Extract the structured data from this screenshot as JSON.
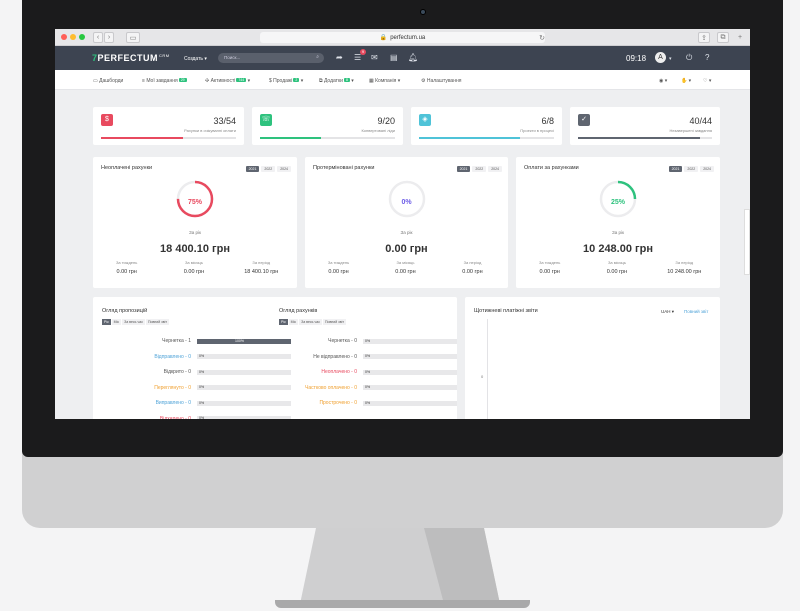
{
  "browser": {
    "url": "perfectum.ua"
  },
  "topbar": {
    "logo_mark": "7",
    "logo_text": "PERFECTUM",
    "logo_sup": "CRM",
    "create_label": "Создать",
    "search_placeholder": "Поиск...",
    "notif_count": "9",
    "time": "09:18",
    "avatar_letter": "A"
  },
  "menu": [
    {
      "label": "Дашборди"
    },
    {
      "label": "Мої завдання",
      "badge": "29"
    },
    {
      "label": "Активності",
      "badge": "744"
    },
    {
      "label": "Продажі",
      "badge": "2"
    },
    {
      "label": "Додатки",
      "badge": "8"
    },
    {
      "label": "Компанія"
    },
    {
      "label": "Налаштування"
    }
  ],
  "stats": [
    {
      "value": "33/54",
      "label": "Рахунки в очікуванні оплати",
      "color": "#e84a5f",
      "progress": 0.61
    },
    {
      "value": "9/20",
      "label": "Конвертовані ліди",
      "color": "#2ec27e",
      "progress": 0.45
    },
    {
      "value": "6/8",
      "label": "Проекти в процесі",
      "color": "#4fc3d8",
      "progress": 0.75
    },
    {
      "value": "40/44",
      "label": "Незавершені завдання",
      "color": "#5f6570",
      "progress": 0.91
    }
  ],
  "panels": [
    {
      "title": "Неоплачені рахунки",
      "years": [
        "2021",
        "2022",
        "2024"
      ],
      "percent": "75%",
      "ring_color": "#e84a5f",
      "ring_fraction": 0.75,
      "period": "За рік",
      "total": "18 400.10 грн",
      "subs": [
        {
          "label": "За тиждень",
          "value": "0.00 грн"
        },
        {
          "label": "За місяць",
          "value": "0.00 грн"
        },
        {
          "label": "За період",
          "value": "18 400.10 грн"
        }
      ]
    },
    {
      "title": "Протерміновані рахунки",
      "years": [
        "2021",
        "2022",
        "2024"
      ],
      "percent": "0%",
      "ring_color": "#6c5ce7",
      "ring_fraction": 0,
      "period": "За рік",
      "total": "0.00 грн",
      "subs": [
        {
          "label": "За тиждень",
          "value": "0.00 грн"
        },
        {
          "label": "За місяць",
          "value": "0.00 грн"
        },
        {
          "label": "За період",
          "value": "0.00 грн"
        }
      ]
    },
    {
      "title": "Оплати за рахунками",
      "years": [
        "2021",
        "2022",
        "2024"
      ],
      "percent": "25%",
      "ring_color": "#2ec27e",
      "ring_fraction": 0.25,
      "period": "За рік",
      "total": "10 248.00 грн",
      "subs": [
        {
          "label": "За тиждень",
          "value": "0.00 грн"
        },
        {
          "label": "За місяць",
          "value": "0.00 грн"
        },
        {
          "label": "За період",
          "value": "10 248.00 грн"
        }
      ]
    }
  ],
  "proposals": {
    "title": "Огляд пропозицій",
    "tabs": [
      "Рік",
      "Міс",
      "За весь час",
      "Повний звіт"
    ],
    "rows": [
      {
        "label": "Чернетка - 1",
        "pct": "100%",
        "fraction": 1,
        "color": "#555"
      },
      {
        "label": "Відправлено - 0",
        "pct": "0%",
        "fraction": 0,
        "color": "#4fa3d8"
      },
      {
        "label": "Відкрито - 0",
        "pct": "0%",
        "fraction": 0,
        "color": "#555"
      },
      {
        "label": "Переглянуто - 0",
        "pct": "0%",
        "fraction": 0,
        "color": "#f0a030"
      },
      {
        "label": "Виправлено - 0",
        "pct": "0%",
        "fraction": 0,
        "color": "#4fa3d8"
      },
      {
        "label": "Відхилено - 0",
        "pct": "0%",
        "fraction": 0,
        "color": "#e84a5f"
      }
    ]
  },
  "invoices": {
    "title": "Огляд рахунків",
    "tabs": [
      "Рік",
      "Міс",
      "За весь час",
      "Повний звіт"
    ],
    "rows": [
      {
        "label": "Чернетка - 0",
        "pct": "0%",
        "fraction": 0,
        "color": "#555"
      },
      {
        "label": "Не відправлено - 0",
        "pct": "0%",
        "fraction": 0,
        "color": "#555"
      },
      {
        "label": "Неоплачено - 0",
        "pct": "0%",
        "fraction": 0,
        "color": "#e84a5f"
      },
      {
        "label": "Частково оплачено - 0",
        "pct": "0%",
        "fraction": 0,
        "color": "#f0a030"
      },
      {
        "label": "Прострочено - 0",
        "pct": "0%",
        "fraction": 0,
        "color": "#f0a030"
      }
    ]
  },
  "weekly": {
    "title": "Щотижневі платіжні звіти",
    "currency": "UAH",
    "full_report": "Повний звіт",
    "y_tick": "0"
  },
  "colors": {
    "accent": "#2ec27e",
    "topbar": "#3d4451"
  }
}
